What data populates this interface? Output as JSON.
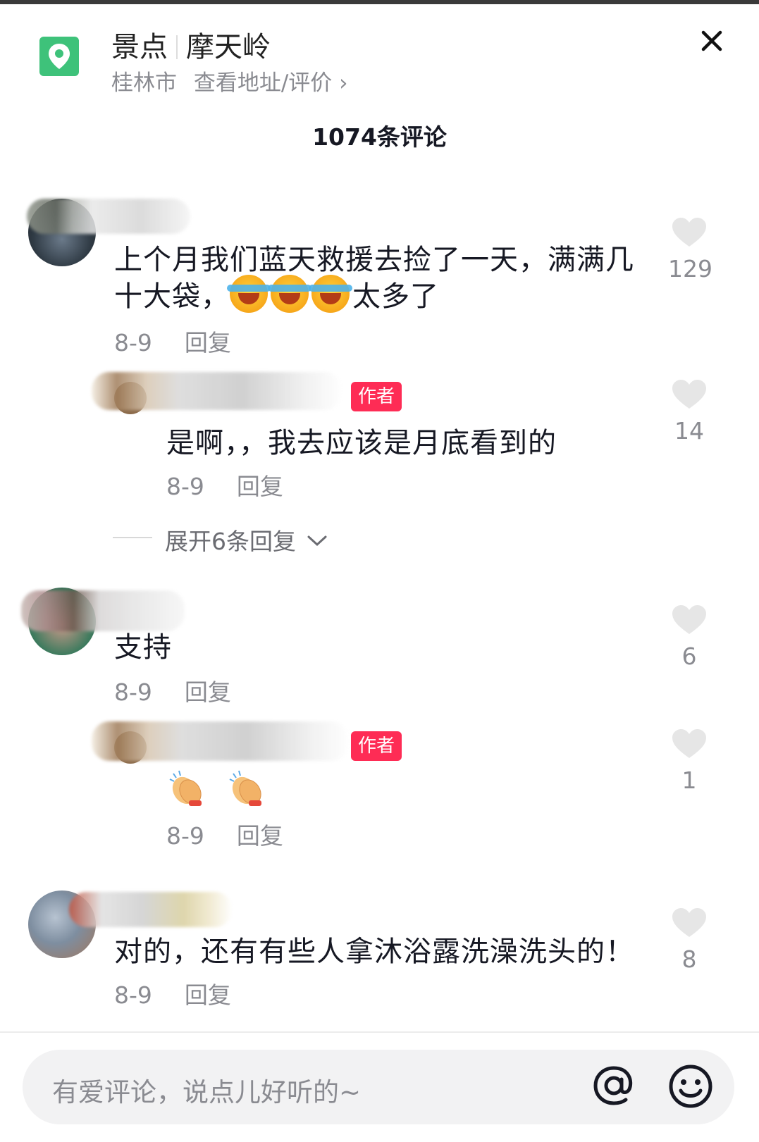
{
  "header": {
    "category": "景点",
    "place_name": "摩天岭",
    "city": "桂林市",
    "address_link": "查看地址/评价",
    "chevron": "›"
  },
  "comment_count_label": "1074条评论",
  "comments": [
    {
      "text_line1": "上个月我们蓝天救援去捡了一天，满满几",
      "text_line2_prefix": "十大袋，",
      "text_line2_suffix": "太多了",
      "date": "8-9",
      "reply": "回复",
      "likes": "129",
      "replies": [
        {
          "author_tag": "作者",
          "text": "是啊，，我去应该是月底看到的",
          "date": "8-9",
          "reply": "回复",
          "likes": "14"
        }
      ],
      "expand_label": "展开6条回复"
    },
    {
      "text": "支持",
      "date": "8-9",
      "reply": "回复",
      "likes": "6",
      "replies": [
        {
          "author_tag": "作者",
          "date": "8-9",
          "reply": "回复",
          "likes": "1"
        }
      ]
    },
    {
      "text": "对的，还有有些人拿沐浴露洗澡洗头的！",
      "date": "8-9",
      "reply": "回复",
      "likes": "8"
    }
  ],
  "input": {
    "placeholder": "有爱评论，说点儿好听的~"
  },
  "icons": {
    "location": "location-pin-icon",
    "close": "close-icon",
    "heart": "heart-icon",
    "at": "at-mention-icon",
    "emoji": "emoji-smile-icon"
  },
  "colors": {
    "accent_green": "#3ec27a",
    "author_tag": "#fe2c55",
    "heart_gray": "#e6e6e6"
  }
}
